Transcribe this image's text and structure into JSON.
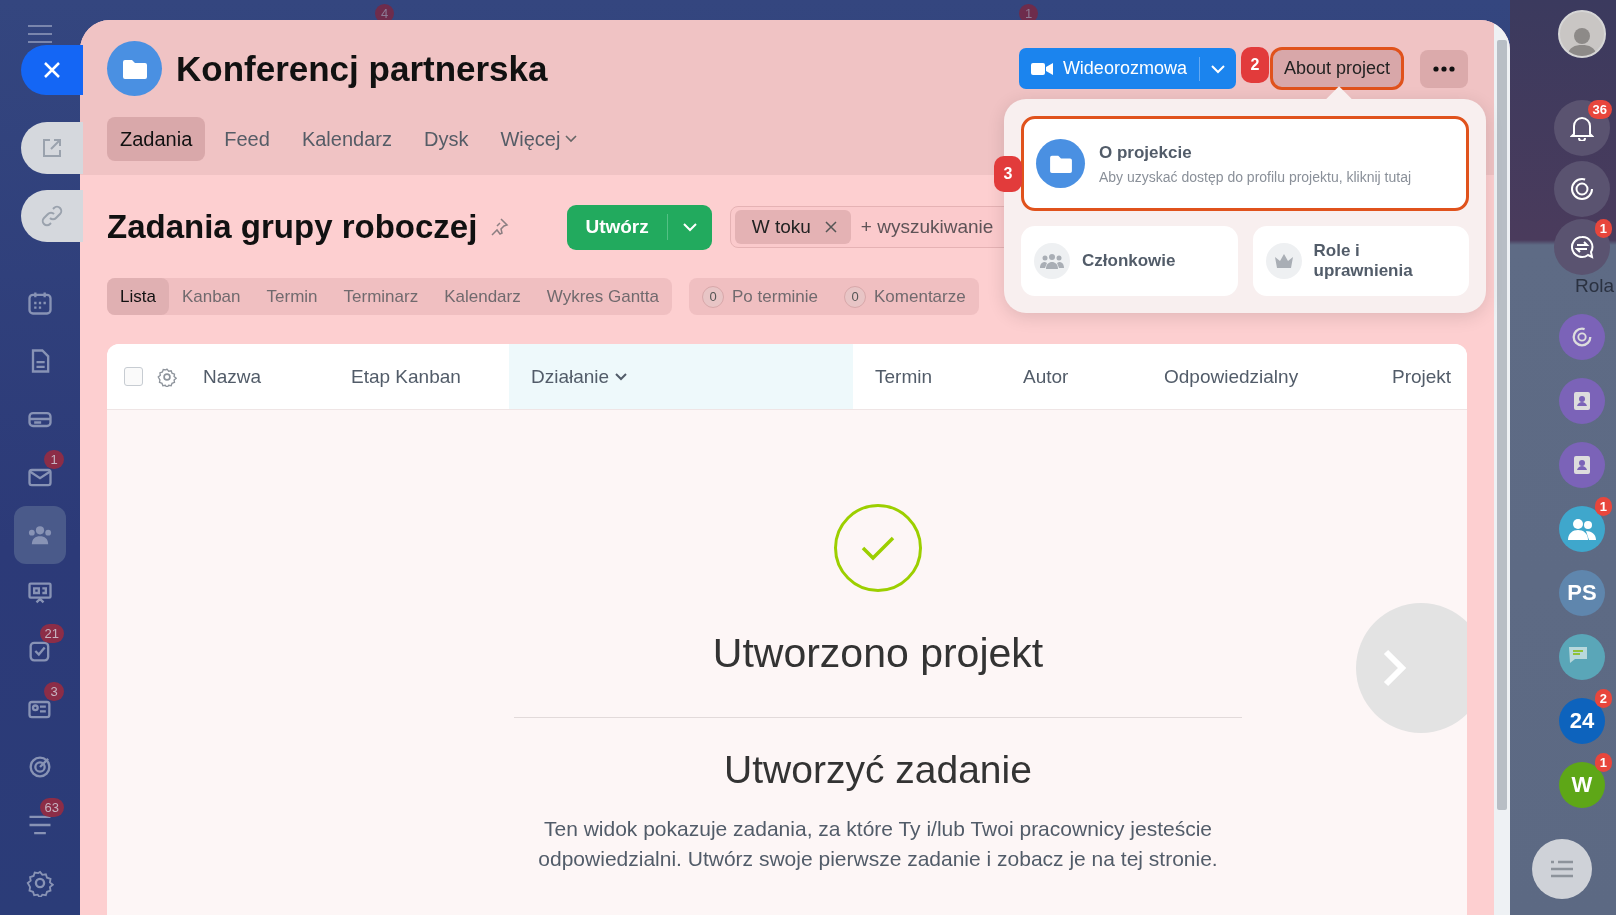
{
  "top_badges": [
    "4",
    "1"
  ],
  "nav_sidebar": {
    "items": [
      {
        "kind": "calendar",
        "selected": false
      },
      {
        "kind": "document",
        "selected": false
      },
      {
        "kind": "drive",
        "selected": false
      },
      {
        "kind": "mail",
        "selected": false,
        "badge": "1"
      },
      {
        "kind": "groups",
        "selected": true
      },
      {
        "kind": "presentation",
        "selected": false
      },
      {
        "kind": "tasks",
        "selected": false,
        "badge": "21"
      },
      {
        "kind": "contacts",
        "selected": false,
        "badge": "3"
      },
      {
        "kind": "target",
        "selected": false
      },
      {
        "kind": "stream",
        "selected": false,
        "badge": "63"
      },
      {
        "kind": "settings",
        "selected": false
      }
    ]
  },
  "project": {
    "title": "Konferencj partnerska",
    "tabs": [
      {
        "label": "Zadania",
        "selected": true,
        "has_menu": false
      },
      {
        "label": "Feed",
        "selected": false,
        "has_menu": false
      },
      {
        "label": "Kalendarz",
        "selected": false,
        "has_menu": false
      },
      {
        "label": "Dysk",
        "selected": false,
        "has_menu": false
      },
      {
        "label": "Więcej",
        "selected": false,
        "has_menu": true
      }
    ],
    "video_button": "Wideorozmowa",
    "about_button": {
      "label": "About project",
      "highlighted": true,
      "step": "2"
    }
  },
  "popup": {
    "main": {
      "title": "O projekcie",
      "description": "Aby uzyskać dostęp do profilu projektu, kliknij tutaj",
      "highlighted": true,
      "step": "3"
    },
    "cards": [
      {
        "label": "Członkowie",
        "kind": "members"
      },
      {
        "label": "Role i uprawnienia",
        "kind": "roles"
      }
    ]
  },
  "page": {
    "title": "Zadania grupy roboczej",
    "create_button": "Utwórz",
    "filter": {
      "chip": "W toku",
      "placeholder": "+ wyszukiwanie"
    },
    "views": [
      {
        "label": "Lista",
        "selected": true
      },
      {
        "label": "Kanban",
        "selected": false
      },
      {
        "label": "Termin",
        "selected": false
      },
      {
        "label": "Terminarz",
        "selected": false
      },
      {
        "label": "Kalendarz",
        "selected": false
      },
      {
        "label": "Wykres Gantta",
        "selected": false
      }
    ],
    "counters": [
      {
        "count": "0",
        "label": "Po terminie"
      },
      {
        "count": "0",
        "label": "Komentarze"
      }
    ]
  },
  "table": {
    "select_all_checked": false,
    "columns": [
      {
        "label": "Nazwa",
        "sorted": false
      },
      {
        "label": "Etap Kanban",
        "sorted": false
      },
      {
        "label": "Działanie",
        "sorted": true
      },
      {
        "label": "Termin",
        "sorted": false
      },
      {
        "label": "Autor",
        "sorted": false
      },
      {
        "label": "Odpowiedzialny",
        "sorted": false
      },
      {
        "label": "Projekt",
        "sorted": false
      }
    ]
  },
  "empty_state": {
    "title": "Utworzono projekt",
    "subtitle": "Utworzyć zadanie",
    "text": "Ten widok pokazuje zadania, za które Ty i/lub Twoi pracownicy jesteście odpowiedzialni. Utwórz swoje pierwsze zadanie i zobacz je na tej stronie."
  },
  "right_bar": {
    "notifications_badge": "36",
    "chat_badge": "1",
    "label": "Rola",
    "apps": [
      {
        "kind": "ai",
        "color": "#7b63b8"
      },
      {
        "kind": "contact",
        "color": "#7b63b8"
      },
      {
        "kind": "contact",
        "color": "#7b63b8"
      },
      {
        "kind": "group",
        "color": "#3fa7cc",
        "badge": "1"
      },
      {
        "kind": "text",
        "text": "PS",
        "color": "#5f86ad"
      },
      {
        "kind": "chat",
        "color": "#5aa6b8"
      },
      {
        "kind": "text",
        "text": "24",
        "color": "#0d63bd",
        "badge": "2"
      },
      {
        "kind": "text",
        "text": "W",
        "color": "#5ea717",
        "badge": "1"
      }
    ]
  }
}
